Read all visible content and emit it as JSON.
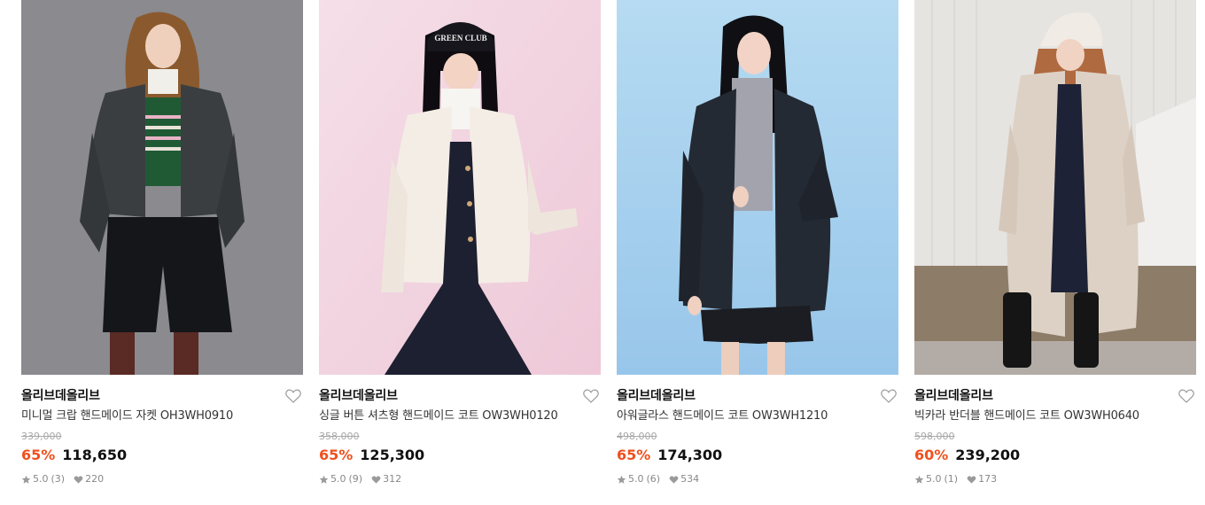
{
  "products": [
    {
      "brand": "올리브데올리브",
      "name": "미니멀 크랍 핸드메이드 자켓 OH3WH0910",
      "original_price": "339,000",
      "discount": "65%",
      "price": "118,650",
      "rating": "5.0",
      "reviews": "(3)",
      "likes": "220",
      "photo_bg": "#8e8e93"
    },
    {
      "brand": "올리브데올리브",
      "name": "싱글 버튼 셔츠형 핸드메이드 코트 OW3WH0120",
      "original_price": "358,000",
      "discount": "65%",
      "price": "125,300",
      "rating": "5.0",
      "reviews": "(9)",
      "likes": "312",
      "photo_bg": "#f2d2df"
    },
    {
      "brand": "올리브데올리브",
      "name": "아워글라스 핸드메이드 코트 OW3WH1210",
      "original_price": "498,000",
      "discount": "65%",
      "price": "174,300",
      "rating": "5.0",
      "reviews": "(6)",
      "likes": "534",
      "photo_bg": "#a9d3ee"
    },
    {
      "brand": "올리브데올리브",
      "name": "빅카라 반더블 핸드메이드 코트 OW3WH0640",
      "original_price": "598,000",
      "discount": "60%",
      "price": "239,200",
      "rating": "5.0",
      "reviews": "(1)",
      "likes": "173",
      "photo_bg": "#e6e4e1"
    }
  ],
  "hat_text": "GREEN CLUB",
  "icons": {
    "wishlist": "heart-outline-icon",
    "rating": "star-icon",
    "likes": "heart-filled-icon"
  },
  "colors": {
    "discount": "#f0501e",
    "brand_text": "#111111",
    "muted": "#888888"
  }
}
